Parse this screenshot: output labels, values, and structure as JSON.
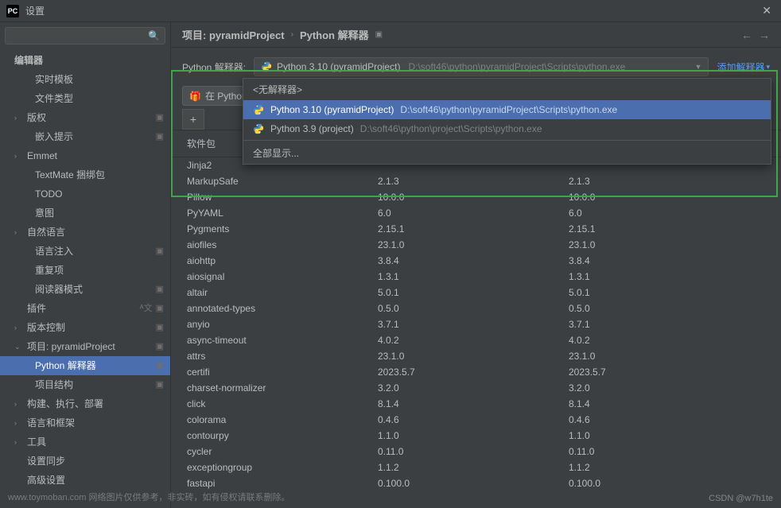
{
  "titlebar": {
    "icon": "PC",
    "title": "设置"
  },
  "search": {
    "placeholder": ""
  },
  "sidebar": {
    "groups": [
      {
        "label": "编辑器",
        "header": true
      },
      {
        "label": "实时模板",
        "sub": true
      },
      {
        "label": "文件类型",
        "sub": true
      },
      {
        "label": "版权",
        "exp": true,
        "chev": "›",
        "badge": true
      },
      {
        "label": "嵌入提示",
        "sub": true,
        "badge": true
      },
      {
        "label": "Emmet",
        "exp": true,
        "chev": "›"
      },
      {
        "label": "TextMate 捆绑包",
        "sub": true
      },
      {
        "label": "TODO",
        "sub": true
      },
      {
        "label": "意图",
        "sub": true
      },
      {
        "label": "自然语言",
        "exp": true,
        "chev": "›"
      },
      {
        "label": "语言注入",
        "sub": true,
        "badge": true
      },
      {
        "label": "重复项",
        "sub": true
      },
      {
        "label": "阅读器模式",
        "sub": true,
        "badge": true
      },
      {
        "label": "插件",
        "plain": true,
        "lang": true
      },
      {
        "label": "版本控制",
        "exp": true,
        "chev": "›",
        "badge": true
      },
      {
        "label": "项目: pyramidProject",
        "exp": true,
        "chev": "⌄",
        "badge": true
      },
      {
        "label": "Python 解释器",
        "sub2": true,
        "selected": true,
        "badge": true
      },
      {
        "label": "项目结构",
        "sub2": true,
        "badge": true
      },
      {
        "label": "构建、执行、部署",
        "exp": true,
        "chev": "›"
      },
      {
        "label": "语言和框架",
        "exp": true,
        "chev": "›"
      },
      {
        "label": "工具",
        "exp": true,
        "chev": "›"
      },
      {
        "label": "设置同步",
        "plain": true
      },
      {
        "label": "高级设置",
        "plain": true
      }
    ]
  },
  "breadcrumb": {
    "a": "项目: pyramidProject",
    "b": "Python 解释器"
  },
  "interpreter": {
    "label": "Python 解释器:",
    "name": "Python 3.10 (pyramidProject)",
    "path": "D:\\soft46\\python\\pyramidProject\\Scripts\\python.exe",
    "add": "添加解释器"
  },
  "toolbar": {
    "try_btn": "在 Python 软件包 工具窗口",
    "close": "✕"
  },
  "pkg_header": {
    "name": "软件包"
  },
  "dropdown": {
    "none": "<无解释器>",
    "opt1_name": "Python 3.10 (pyramidProject)",
    "opt1_path": "D:\\soft46\\python\\pyramidProject\\Scripts\\python.exe",
    "opt2_name": "Python 3.9 (project)",
    "opt2_path": "D:\\soft46\\python\\project\\Scripts\\python.exe",
    "show_all": "全部显示..."
  },
  "packages": [
    {
      "name": "Jinja2",
      "v1": "",
      "v2": ""
    },
    {
      "name": "MarkupSafe",
      "v1": "2.1.3",
      "v2": "2.1.3"
    },
    {
      "name": "Pillow",
      "v1": "10.0.0",
      "v2": "10.0.0"
    },
    {
      "name": "PyYAML",
      "v1": "6.0",
      "v2": "6.0"
    },
    {
      "name": "Pygments",
      "v1": "2.15.1",
      "v2": "2.15.1"
    },
    {
      "name": "aiofiles",
      "v1": "23.1.0",
      "v2": "23.1.0"
    },
    {
      "name": "aiohttp",
      "v1": "3.8.4",
      "v2": "3.8.4"
    },
    {
      "name": "aiosignal",
      "v1": "1.3.1",
      "v2": "1.3.1"
    },
    {
      "name": "altair",
      "v1": "5.0.1",
      "v2": "5.0.1"
    },
    {
      "name": "annotated-types",
      "v1": "0.5.0",
      "v2": "0.5.0"
    },
    {
      "name": "anyio",
      "v1": "3.7.1",
      "v2": "3.7.1"
    },
    {
      "name": "async-timeout",
      "v1": "4.0.2",
      "v2": "4.0.2"
    },
    {
      "name": "attrs",
      "v1": "23.1.0",
      "v2": "23.1.0"
    },
    {
      "name": "certifi",
      "v1": "2023.5.7",
      "v2": "2023.5.7"
    },
    {
      "name": "charset-normalizer",
      "v1": "3.2.0",
      "v2": "3.2.0"
    },
    {
      "name": "click",
      "v1": "8.1.4",
      "v2": "8.1.4"
    },
    {
      "name": "colorama",
      "v1": "0.4.6",
      "v2": "0.4.6"
    },
    {
      "name": "contourpy",
      "v1": "1.1.0",
      "v2": "1.1.0"
    },
    {
      "name": "cycler",
      "v1": "0.11.0",
      "v2": "0.11.0"
    },
    {
      "name": "exceptiongroup",
      "v1": "1.1.2",
      "v2": "1.1.2"
    },
    {
      "name": "fastapi",
      "v1": "0.100.0",
      "v2": "0.100.0"
    }
  ],
  "watermark": "CSDN @w7h1te",
  "watermark2": "www.toymoban.com 网络图片仅供参考，非实砖，如有侵权请联系删除。"
}
